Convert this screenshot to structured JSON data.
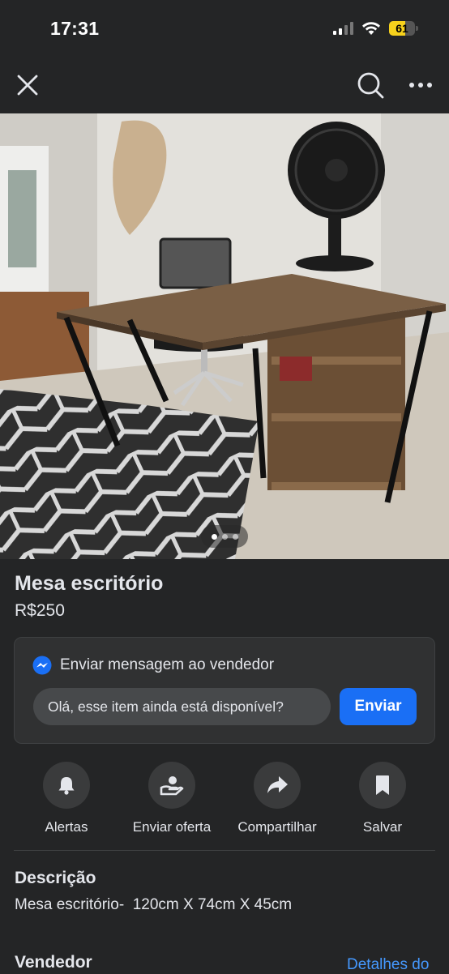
{
  "status_bar": {
    "time": "17:31",
    "battery": "61",
    "battery_level": 0.61
  },
  "nav": {
    "close_icon": "close-icon",
    "search_icon": "search-icon",
    "more_icon": "more-icon"
  },
  "listing": {
    "title": "Mesa escritório",
    "price": "R$250",
    "photo_count": 3,
    "photo_active_index": 0
  },
  "message": {
    "heading": "Enviar mensagem ao vendedor",
    "input_value": "Olá, esse item ainda está disponível?",
    "send_label": "Enviar"
  },
  "actions": [
    {
      "label": "Alertas",
      "icon": "bell-icon"
    },
    {
      "label": "Enviar oferta",
      "icon": "offer-icon"
    },
    {
      "label": "Compartilhar",
      "icon": "share-icon"
    },
    {
      "label": "Salvar",
      "icon": "bookmark-icon"
    }
  ],
  "description": {
    "heading": "Descrição",
    "text": "Mesa escritório-  120cm X 74cm X 45cm"
  },
  "seller": {
    "heading": "Vendedor",
    "details_link": "Detalhes do"
  },
  "colors": {
    "background": "#242526",
    "accent": "#1a6ff5",
    "link": "#4599ff",
    "battery": "#f7d21c"
  }
}
